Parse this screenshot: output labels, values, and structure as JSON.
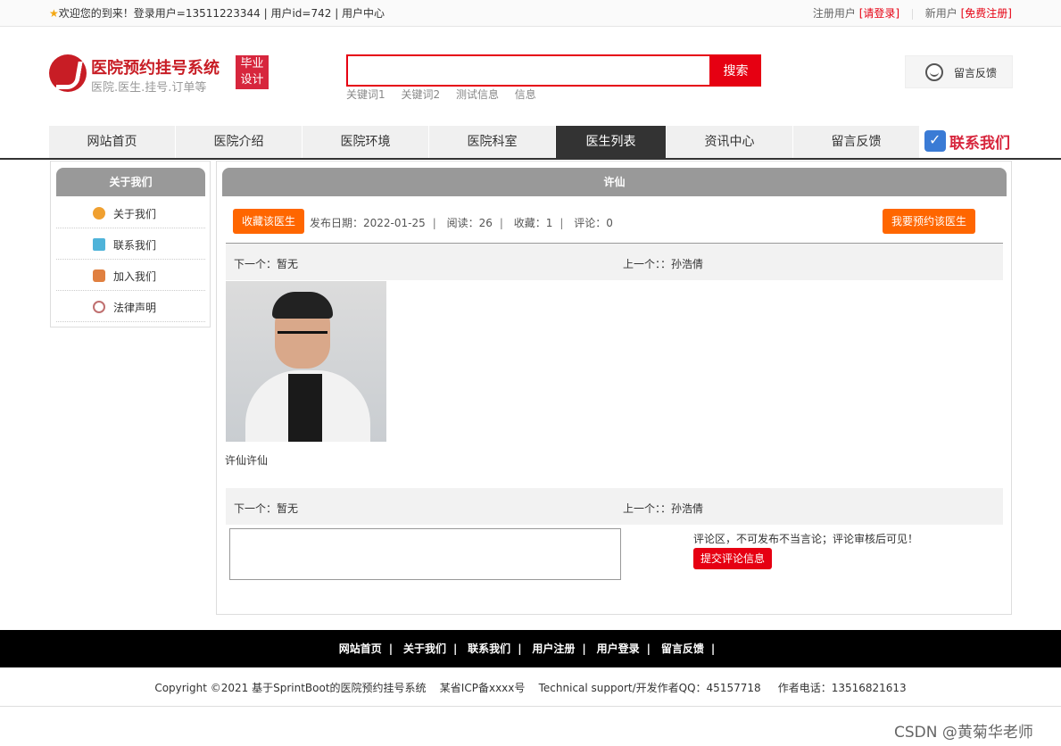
{
  "topbar": {
    "welcome": "欢迎您的到来！登录用户=13511223344 | 用户id=742 | 用户中心",
    "register_label": "注册用户",
    "login_link": "[请登录]",
    "newuser_label": "新用户",
    "free_register_link": "[免费注册]"
  },
  "logo": {
    "title": "医院预约挂号系统",
    "subtitle": "医院.医生.挂号.订单等",
    "badge_line1": "毕业",
    "badge_line2": "设计"
  },
  "search": {
    "placeholder": "",
    "button": "搜索",
    "keywords": [
      "关键词1",
      "关键词2",
      "测试信息",
      "信息"
    ]
  },
  "feedback_button": "留言反馈",
  "nav": {
    "items": [
      "网站首页",
      "医院介绍",
      "医院环境",
      "医院科室",
      "医生列表",
      "资讯中心",
      "留言反馈"
    ],
    "active_index": 4,
    "contact": "联系我们"
  },
  "sidebar": {
    "title": "关于我们",
    "items": [
      {
        "label": "关于我们",
        "icon": "circle-icon",
        "color": "#f0a030"
      },
      {
        "label": "联系我们",
        "icon": "document-icon",
        "color": "#4fb3d9"
      },
      {
        "label": "加入我们",
        "icon": "lock-icon",
        "color": "#e08040"
      },
      {
        "label": "法律声明",
        "icon": "power-icon",
        "color": "#c07070"
      }
    ]
  },
  "article": {
    "title": "许仙",
    "collect_button": "收藏该医生",
    "publish_date": "发布日期：2022-01-25",
    "reads": "阅读：26",
    "favorites": "收藏：1",
    "comments": "评论：0",
    "appoint_button": "我要预约该医生",
    "next": "下一个：暂无",
    "prev": "上一个：：孙浩倩",
    "caption": "许仙许仙"
  },
  "comment": {
    "hint": "评论区，不可发布不当言论；评论审核后可见！",
    "submit": "提交评论信息"
  },
  "footer": {
    "links": [
      "网站首页",
      "关于我们",
      "联系我们",
      "用户注册",
      "用户登录",
      "留言反馈"
    ],
    "copyright": "Copyright ©2021 基于SprintBoot的医院预约挂号系统    某省ICP备xxxx号    Technical support/开发作者QQ：45157718     作者电话：13516821613"
  },
  "watermark": "CSDN @黄菊华老师",
  "colors": {
    "accent": "#e60012",
    "orange": "#ff6600",
    "nav_active": "#333333"
  }
}
